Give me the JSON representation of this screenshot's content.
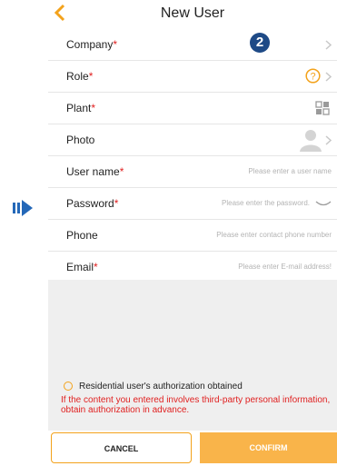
{
  "header": {
    "title": "New User",
    "step_badge": "2"
  },
  "colors": {
    "accent": "#f3a21b",
    "required": "#e02020",
    "badge": "#1e4a86"
  },
  "fields": [
    {
      "label": "Company",
      "required": true,
      "value": "",
      "placeholder": "",
      "icon": "chevron-right-icon"
    },
    {
      "label": "Role",
      "required": true,
      "value": "",
      "placeholder": "",
      "icon": "help-icon"
    },
    {
      "label": "Plant",
      "required": true,
      "value": "",
      "placeholder": "",
      "icon": "qr-code-icon"
    },
    {
      "label": "Photo",
      "required": false,
      "value": "",
      "placeholder": "",
      "icon": "avatar-icon"
    },
    {
      "label": "User name",
      "required": true,
      "value": "",
      "placeholder": "Please enter a user name"
    },
    {
      "label": "Password",
      "required": true,
      "value": "",
      "placeholder": "Please enter the password.",
      "icon": "eye-closed-icon"
    },
    {
      "label": "Phone",
      "required": false,
      "value": "",
      "placeholder": "Please enter contact phone number"
    },
    {
      "label": "Email",
      "required": true,
      "value": "",
      "placeholder": "Please enter E-mail address!"
    }
  ],
  "auth": {
    "label": "Residential user's authorization obtained",
    "checked": false
  },
  "warning": "If the content you entered involves third-party personal information, obtain authorization in advance.",
  "buttons": {
    "cancel": "CANCEL",
    "confirm": "CONFIRM"
  }
}
